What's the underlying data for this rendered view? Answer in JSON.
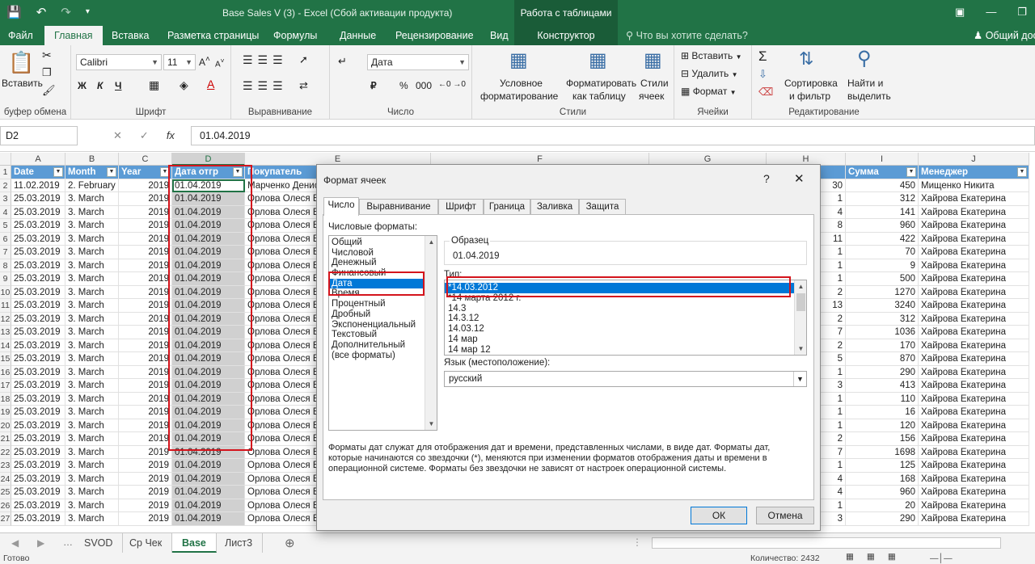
{
  "window": {
    "title": "Base Sales V (3) - Excel (Сбой активации продукта)",
    "context_title": "Работа с таблицами"
  },
  "tabs": [
    "Файл",
    "Главная",
    "Вставка",
    "Разметка страницы",
    "Формулы",
    "Данные",
    "Рецензирование",
    "Вид",
    "Конструктор"
  ],
  "tellme": "Что вы хотите сделать?",
  "share": "Общий дос",
  "ribbon": {
    "clipboard": {
      "paste": "Вставить",
      "label": "буфер обмена"
    },
    "font": {
      "name": "Calibri",
      "size": "11",
      "label": "Шрифт",
      "bold": "Ж",
      "italic": "К",
      "underline": "Ч"
    },
    "alignment": {
      "label": "Выравнивание"
    },
    "number": {
      "format": "Дата",
      "label": "Число",
      "percent": "%",
      "thousands": "000"
    },
    "styles": {
      "conditional_l1": "Условное",
      "conditional_l2": "форматирование",
      "astable_l1": "Форматировать",
      "astable_l2": "как таблицу",
      "cellstyles_l1": "Стили",
      "cellstyles_l2": "ячеек",
      "label": "Стили"
    },
    "cells": {
      "insert": "Вставить",
      "delete": "Удалить",
      "format": "Формат",
      "label": "Ячейки"
    },
    "editing": {
      "sort_l1": "Сортировка",
      "sort_l2": "и фильтр",
      "find_l1": "Найти и",
      "find_l2": "выделить",
      "label": "Редактирование"
    }
  },
  "formula_bar": {
    "namebox": "D2",
    "fx": "fx",
    "value": "01.04.2019"
  },
  "columns": [
    "A",
    "B",
    "C",
    "D",
    "E",
    "F",
    "G",
    "H",
    "I",
    "J"
  ],
  "header_row": [
    "Date",
    "Month",
    "Year",
    "Дата отгр",
    "Покупатель",
    "",
    "",
    "",
    "Сумма",
    "Менеджер"
  ],
  "rows": [
    {
      "n": "2",
      "a": "11.02.2019",
      "b": "2. February",
      "c": "2019",
      "d": "01.04.2019",
      "e": "Марченко Денис",
      "h": "30",
      "i": "450",
      "j": "Мищенко Никита"
    },
    {
      "n": "3",
      "a": "25.03.2019",
      "b": "3. March",
      "c": "2019",
      "d": "01.04.2019",
      "e": "Орлова Олеся Ва",
      "h": "1",
      "i": "312",
      "j": "Хайрова Екатерина"
    },
    {
      "n": "4",
      "a": "25.03.2019",
      "b": "3. March",
      "c": "2019",
      "d": "01.04.2019",
      "e": "Орлова Олеся Ва",
      "h": "4",
      "i": "141",
      "j": "Хайрова Екатерина"
    },
    {
      "n": "5",
      "a": "25.03.2019",
      "b": "3. March",
      "c": "2019",
      "d": "01.04.2019",
      "e": "Орлова Олеся Ва",
      "h": "8",
      "i": "960",
      "j": "Хайрова Екатерина"
    },
    {
      "n": "6",
      "a": "25.03.2019",
      "b": "3. March",
      "c": "2019",
      "d": "01.04.2019",
      "e": "Орлова Олеся Ва",
      "h": "11",
      "i": "422",
      "j": "Хайрова Екатерина"
    },
    {
      "n": "7",
      "a": "25.03.2019",
      "b": "3. March",
      "c": "2019",
      "d": "01.04.2019",
      "e": "Орлова Олеся Ва",
      "h": "1",
      "i": "70",
      "j": "Хайрова Екатерина"
    },
    {
      "n": "8",
      "a": "25.03.2019",
      "b": "3. March",
      "c": "2019",
      "d": "01.04.2019",
      "e": "Орлова Олеся Ва",
      "h": "1",
      "i": "9",
      "j": "Хайрова Екатерина"
    },
    {
      "n": "9",
      "a": "25.03.2019",
      "b": "3. March",
      "c": "2019",
      "d": "01.04.2019",
      "e": "Орлова Олеся Ва",
      "h": "1",
      "i": "500",
      "j": "Хайрова Екатерина"
    },
    {
      "n": "10",
      "a": "25.03.2019",
      "b": "3. March",
      "c": "2019",
      "d": "01.04.2019",
      "e": "Орлова Олеся Ва",
      "h": "2",
      "i": "1270",
      "j": "Хайрова Екатерина"
    },
    {
      "n": "11",
      "a": "25.03.2019",
      "b": "3. March",
      "c": "2019",
      "d": "01.04.2019",
      "e": "Орлова Олеся Ва",
      "h": "13",
      "i": "3240",
      "j": "Хайрова Екатерина"
    },
    {
      "n": "12",
      "a": "25.03.2019",
      "b": "3. March",
      "c": "2019",
      "d": "01.04.2019",
      "e": "Орлова Олеся Ва",
      "h": "2",
      "i": "312",
      "j": "Хайрова Екатерина"
    },
    {
      "n": "13",
      "a": "25.03.2019",
      "b": "3. March",
      "c": "2019",
      "d": "01.04.2019",
      "e": "Орлова Олеся Ва",
      "h": "7",
      "i": "1036",
      "j": "Хайрова Екатерина"
    },
    {
      "n": "14",
      "a": "25.03.2019",
      "b": "3. March",
      "c": "2019",
      "d": "01.04.2019",
      "e": "Орлова Олеся Ва",
      "h": "2",
      "i": "170",
      "j": "Хайрова Екатерина"
    },
    {
      "n": "15",
      "a": "25.03.2019",
      "b": "3. March",
      "c": "2019",
      "d": "01.04.2019",
      "e": "Орлова Олеся Ва",
      "h": "5",
      "i": "870",
      "j": "Хайрова Екатерина"
    },
    {
      "n": "16",
      "a": "25.03.2019",
      "b": "3. March",
      "c": "2019",
      "d": "01.04.2019",
      "e": "Орлова Олеся Ва",
      "h": "1",
      "i": "290",
      "j": "Хайрова Екатерина"
    },
    {
      "n": "17",
      "a": "25.03.2019",
      "b": "3. March",
      "c": "2019",
      "d": "01.04.2019",
      "e": "Орлова Олеся Ва",
      "h": "3",
      "i": "413",
      "j": "Хайрова Екатерина"
    },
    {
      "n": "18",
      "a": "25.03.2019",
      "b": "3. March",
      "c": "2019",
      "d": "01.04.2019",
      "e": "Орлова Олеся Ва",
      "h": "1",
      "i": "110",
      "j": "Хайрова Екатерина"
    },
    {
      "n": "19",
      "a": "25.03.2019",
      "b": "3. March",
      "c": "2019",
      "d": "01.04.2019",
      "e": "Орлова Олеся Ва",
      "h": "1",
      "i": "16",
      "j": "Хайрова Екатерина"
    },
    {
      "n": "20",
      "a": "25.03.2019",
      "b": "3. March",
      "c": "2019",
      "d": "01.04.2019",
      "e": "Орлова Олеся Ва",
      "h": "1",
      "i": "120",
      "j": "Хайрова Екатерина"
    },
    {
      "n": "21",
      "a": "25.03.2019",
      "b": "3. March",
      "c": "2019",
      "d": "01.04.2019",
      "e": "Орлова Олеся Ва",
      "h": "2",
      "i": "156",
      "j": "Хайрова Екатерина"
    },
    {
      "n": "22",
      "a": "25.03.2019",
      "b": "3. March",
      "c": "2019",
      "d": "01.04.2019",
      "e": "Орлова Олеся Ва",
      "h": "7",
      "i": "1698",
      "j": "Хайрова Екатерина"
    },
    {
      "n": "23",
      "a": "25.03.2019",
      "b": "3. March",
      "c": "2019",
      "d": "01.04.2019",
      "e": "Орлова Олеся Ва",
      "h": "1",
      "i": "125",
      "j": "Хайрова Екатерина"
    },
    {
      "n": "24",
      "a": "25.03.2019",
      "b": "3. March",
      "c": "2019",
      "d": "01.04.2019",
      "e": "Орлова Олеся Ва",
      "h": "4",
      "i": "168",
      "j": "Хайрова Екатерина"
    },
    {
      "n": "25",
      "a": "25.03.2019",
      "b": "3. March",
      "c": "2019",
      "d": "01.04.2019",
      "e": "Орлова Олеся Ва",
      "h": "4",
      "i": "960",
      "j": "Хайрова Екатерина"
    },
    {
      "n": "26",
      "a": "25.03.2019",
      "b": "3. March",
      "c": "2019",
      "d": "01.04.2019",
      "e": "Орлова Олеся Ва",
      "h": "1",
      "i": "20",
      "j": "Хайрова Екатерина"
    },
    {
      "n": "27",
      "a": "25.03.2019",
      "b": "3. March",
      "c": "2019",
      "d": "01.04.2019",
      "e": "Орлова Олеся Ва",
      "h": "3",
      "i": "290",
      "j": "Хайрова Екатерина"
    }
  ],
  "sheets": [
    "SVOD",
    "Ср Чек",
    "Base",
    "Лист3"
  ],
  "status": {
    "ready": "Готово",
    "count": "Количество: 2432"
  },
  "dialog": {
    "title": "Формат ячеек",
    "help": "?",
    "tabs": [
      "Число",
      "Выравнивание",
      "Шрифт",
      "Граница",
      "Заливка",
      "Защита"
    ],
    "formats_label": "Числовые форматы:",
    "categories": [
      "Общий",
      "Числовой",
      "Денежный",
      "Финансовый",
      "Дата",
      "Время",
      "Процентный",
      "Дробный",
      "Экспоненциальный",
      "Текстовый",
      "Дополнительный",
      "(все форматы)"
    ],
    "selected_category": "Дата",
    "sample_label": "Образец",
    "sample_value": "01.04.2019",
    "type_label": "Тип:",
    "types": [
      "*14.03.2012",
      "*14 марта 2012 г.",
      "14.3",
      "14.3.12",
      "14.03.12",
      "14 мар",
      "14 мар 12"
    ],
    "lang_label": "Язык (местоположение):",
    "lang_value": "русский",
    "description": "Форматы дат служат для отображения дат и времени, представленных числами, в виде дат. Форматы дат, которые начинаются со звездочки (*), меняются при изменении форматов отображения даты и времени в операционной системе. Форматы без звездочки не зависят от настроек операционной системы.",
    "ok": "ОК",
    "cancel": "Отмена"
  },
  "colors": {
    "excel_green": "#217346",
    "table_header": "#5b9bd5",
    "selection_blue": "#0078d7",
    "highlight_red": "#d4141c"
  }
}
